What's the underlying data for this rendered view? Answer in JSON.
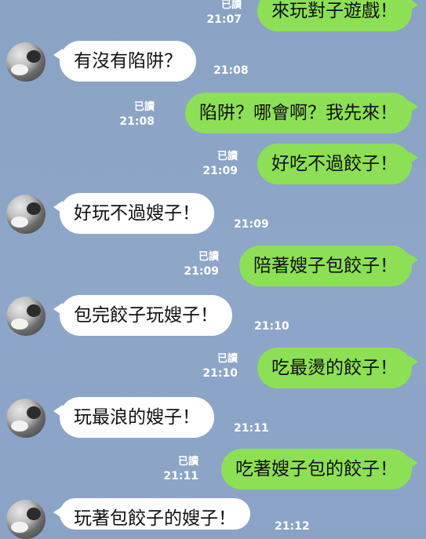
{
  "colors": {
    "background": "#8ea6c8",
    "outgoing_bubble": "#8de055",
    "incoming_bubble": "#ffffff"
  },
  "read_label": "已讀",
  "messages": [
    {
      "direction": "out",
      "text": "來玩對子遊戲！",
      "time": "21:07",
      "read": true
    },
    {
      "direction": "in",
      "text": "有沒有陷阱？",
      "time": "21:08"
    },
    {
      "direction": "out",
      "text": "陷阱？哪會啊？我先來！",
      "time": "21:08",
      "read": true
    },
    {
      "direction": "out",
      "text": "好吃不過餃子！",
      "time": "21:09",
      "read": true
    },
    {
      "direction": "in",
      "text": "好玩不過嫂子！",
      "time": "21:09"
    },
    {
      "direction": "out",
      "text": "陪著嫂子包餃子！",
      "time": "21:09",
      "read": true
    },
    {
      "direction": "in",
      "text": "包完餃子玩嫂子！",
      "time": "21:10"
    },
    {
      "direction": "out",
      "text": "吃最燙的餃子！",
      "time": "21:10",
      "read": true
    },
    {
      "direction": "in",
      "text": "玩最浪的嫂子！",
      "time": "21:11"
    },
    {
      "direction": "out",
      "text": "吃著嫂子包的餃子！",
      "time": "21:11",
      "read": true
    },
    {
      "direction": "in",
      "text": "玩著包餃子的嫂子！",
      "time": "21:12"
    }
  ]
}
